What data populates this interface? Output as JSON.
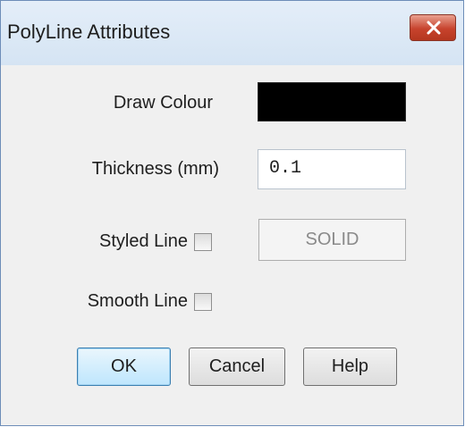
{
  "window": {
    "title": "PolyLine Attributes"
  },
  "fields": {
    "draw_colour_label": "Draw Colour",
    "draw_colour_value": "#000000",
    "thickness_label": "Thickness (mm)",
    "thickness_value": "0.1",
    "styled_line_label": "Styled Line",
    "styled_line_checked": false,
    "line_style_value": "SOLID",
    "smooth_line_label": "Smooth Line",
    "smooth_line_checked": false
  },
  "buttons": {
    "ok": "OK",
    "cancel": "Cancel",
    "help": "Help"
  }
}
